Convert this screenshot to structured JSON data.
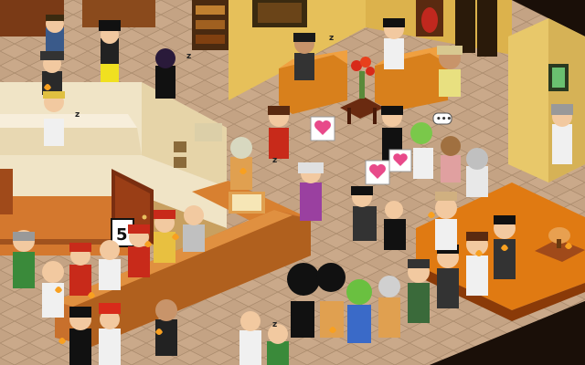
{
  "room": {
    "colors": {
      "floor_light": "#c9a98a",
      "floor_dark": "#b69373",
      "wall_yellow": "#e8c45a",
      "wall_trim": "#a0521e",
      "counter_wood": "#c9732e",
      "counter_top": "#efe3c8",
      "sofa_orange": "#d8801c",
      "carpet_orange": "#e07a12",
      "void": "#1a0f08"
    }
  },
  "sign_number": "5",
  "speech_bubble": "•••",
  "sleep_marker": "z",
  "icons": [
    "heart-sign-icon",
    "sleep-z-icon",
    "speech-bubble-icon",
    "torch-icon"
  ]
}
